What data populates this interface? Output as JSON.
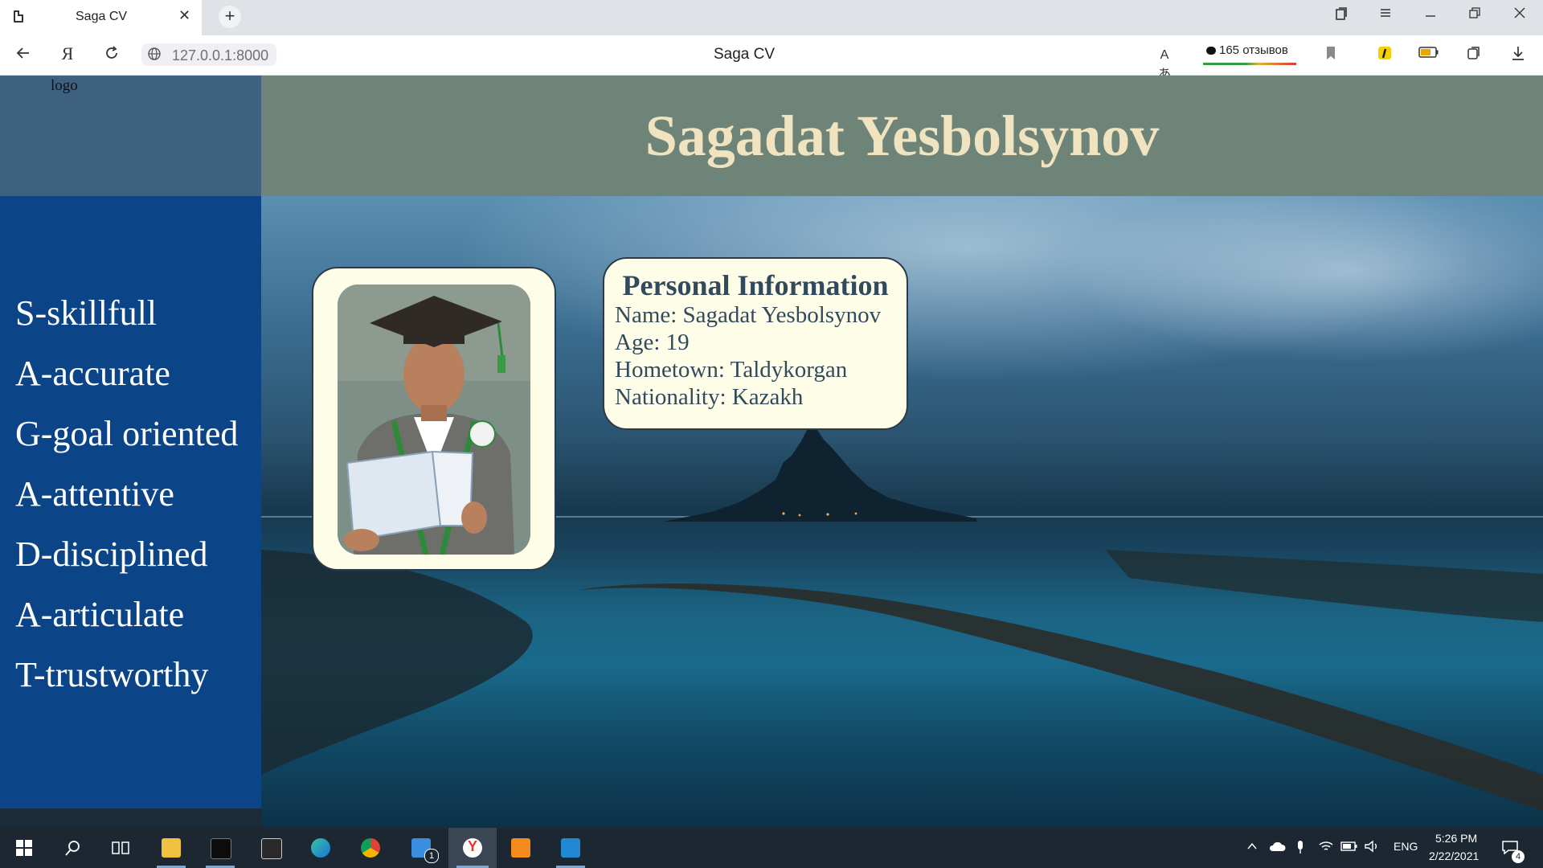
{
  "browser": {
    "tab_title": "Saga CV",
    "tab_close": "✕",
    "new_tab": "+",
    "url": "127.0.0.1:8000",
    "page_title": "Saga CV",
    "reviews_label": "165 отзывов",
    "window_buttons": [
      "bookmarks-icon",
      "menu-icon",
      "minimize-icon",
      "restore-icon",
      "close-icon"
    ],
    "nav_icons": [
      "back-icon",
      "yandex-icon",
      "reload-icon"
    ]
  },
  "page": {
    "logo_alt": "logo",
    "header_name": "Sagadat Yesbolsynov",
    "traits": [
      "S-skillfull",
      "A-accurate",
      "G-goal oriented",
      "A-attentive",
      "D-disciplined",
      "A-articulate",
      "T-trustworthy"
    ],
    "info": {
      "title": "Personal Information",
      "name": "Name: Sagadat Yesbolsynov",
      "age": "Age: 19",
      "hometown": "Hometown: Taldykorgan",
      "nationality": "Nationality: Kazakh"
    }
  },
  "taskbar": {
    "language": "ENG",
    "time": "5:26 PM",
    "date": "2/22/2021",
    "mail_badge": "1",
    "notifications_badge": "4"
  },
  "colors": {
    "sidebar": "#0b4588",
    "logo_box": "#3e6180",
    "header": "#6f8478",
    "header_text": "#efe3c0",
    "card_bg": "#fdfde8",
    "card_text": "#334a5d"
  }
}
